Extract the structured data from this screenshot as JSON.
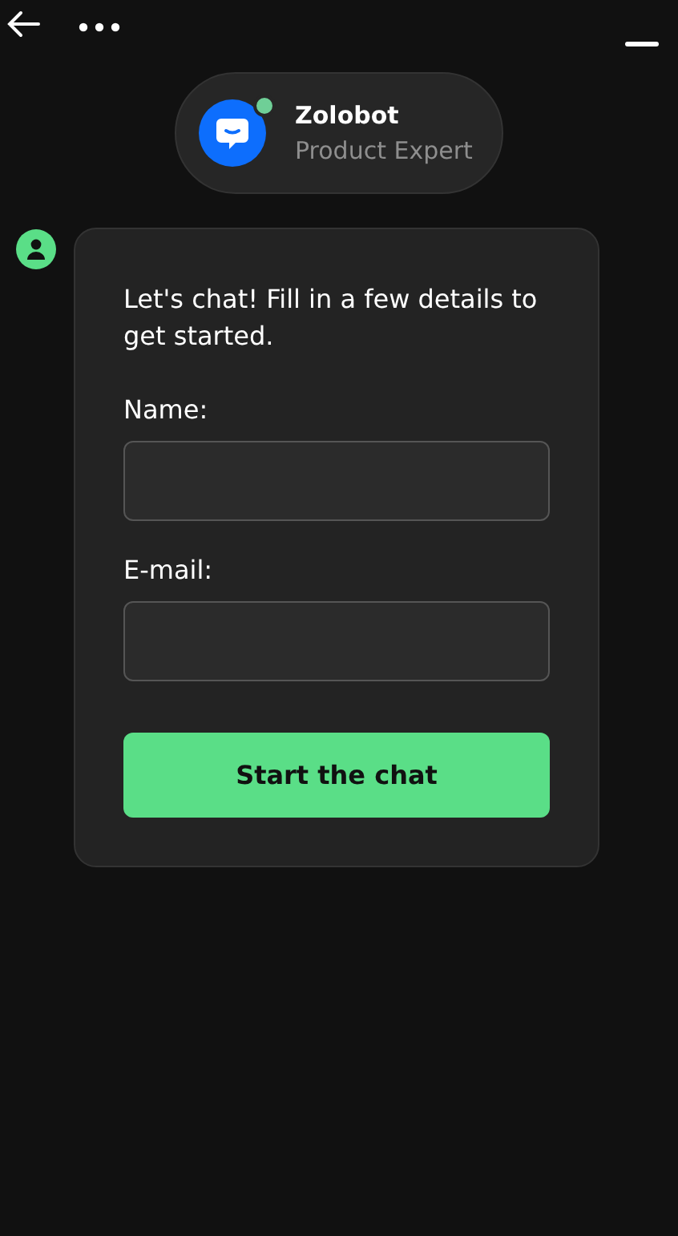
{
  "agent": {
    "name": "Zolobot",
    "role": "Product Expert",
    "online": true
  },
  "form": {
    "intro": "Let's chat! Fill in a few details to get started.",
    "fields": [
      {
        "label": "Name:"
      },
      {
        "label": "E-mail:"
      }
    ],
    "submit": "Start the chat"
  }
}
